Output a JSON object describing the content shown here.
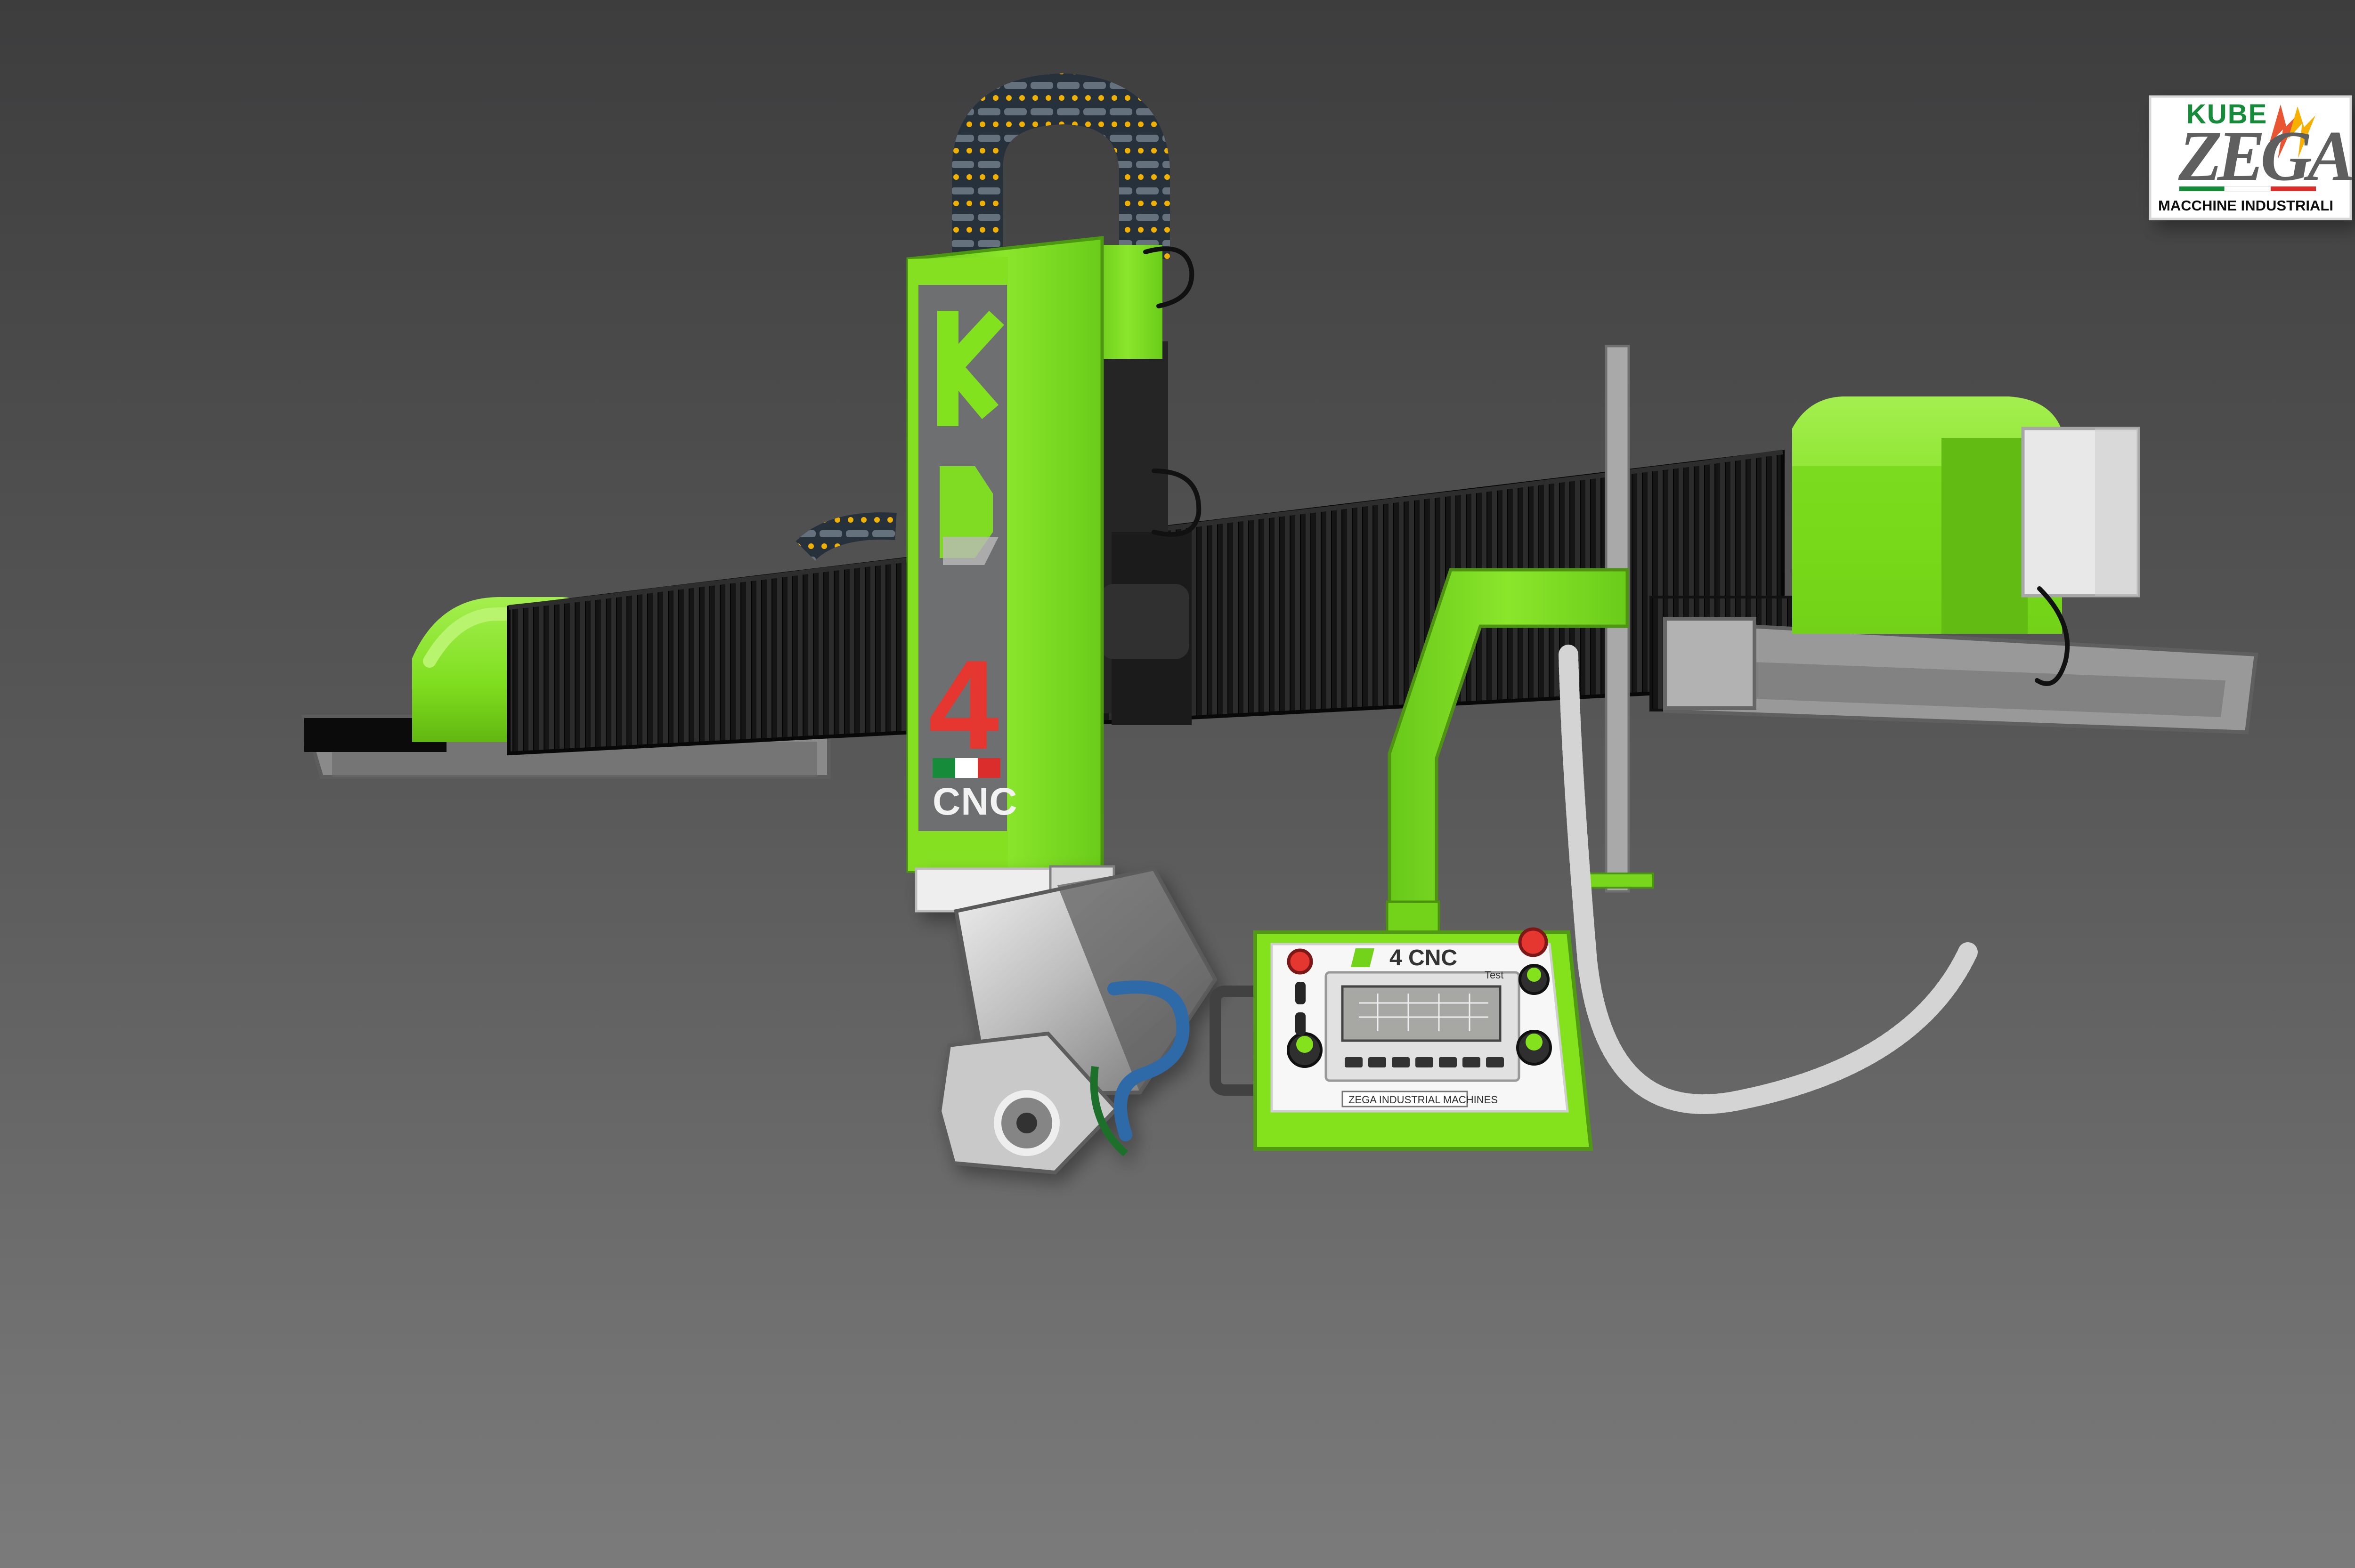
{
  "logo": {
    "top_text": "KUBE",
    "brand": "ZEGA",
    "caption": "MACCHINE INDUSTRIALI"
  },
  "column": {
    "model_number": "4",
    "model_suffix": "CNC"
  },
  "control_panel": {
    "header_brand": "4 CNC",
    "screen_text": "Test",
    "footer_text": "ZEGA INDUSTRIAL MACHINES"
  },
  "colors": {
    "machine_green": "#7fe11e",
    "panel_green": "#84e21d",
    "background_top": "#3f3f40",
    "background_bottom": "#7b7b7b",
    "red_accent": "#e5362f",
    "italy_green": "#168c3b",
    "italy_red": "#da2d2c"
  }
}
